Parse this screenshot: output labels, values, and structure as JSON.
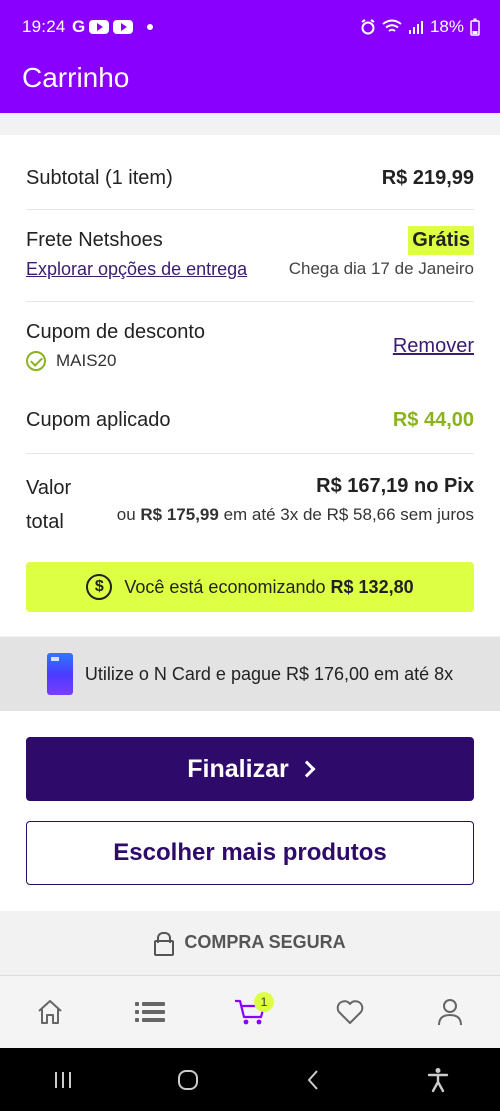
{
  "status": {
    "time": "19:24",
    "left_icons": [
      "G",
      "youtube-icon",
      "youtube-icon",
      "dot-icon"
    ],
    "battery": "18%"
  },
  "header": {
    "title": "Carrinho"
  },
  "summary": {
    "subtotal_label": "Subtotal (1 item)",
    "subtotal_value": "R$ 219,99",
    "shipping_label": "Frete Netshoes",
    "shipping_value": "Grátis",
    "shipping_link": "Explorar opções de entrega",
    "shipping_eta": "Chega dia 17 de Janeiro",
    "coupon_label": "Cupom de desconto",
    "coupon_code": "MAIS20",
    "coupon_remove": "Remover",
    "applied_label": "Cupom aplicado",
    "applied_value": "R$ 44,00",
    "total_label_1": "Valor",
    "total_label_2": "total",
    "total_pix": "R$ 167,19 no Pix",
    "total_or": "ou",
    "total_card_value": "R$ 175,99",
    "total_installments": "em até 3x de R$ 58,66 sem juros",
    "savings_text": "Você está economizando",
    "savings_value": "R$ 132,80"
  },
  "ncard": {
    "text": "Utilize o N Card e pague R$ 176,00 em até 8x"
  },
  "actions": {
    "finalize": "Finalizar",
    "more_products": "Escolher mais produtos"
  },
  "secure": {
    "text": "COMPRA SEGURA"
  },
  "bottom_nav": {
    "items": [
      "home-icon",
      "menu-list-icon",
      "cart-icon",
      "heart-icon",
      "user-icon"
    ],
    "cart_badge": "1",
    "active": "cart-icon"
  },
  "colors": {
    "header": "#8a00ff",
    "primary": "#2e0a6b",
    "highlight": "#ddff44",
    "success": "#8ab31e"
  }
}
